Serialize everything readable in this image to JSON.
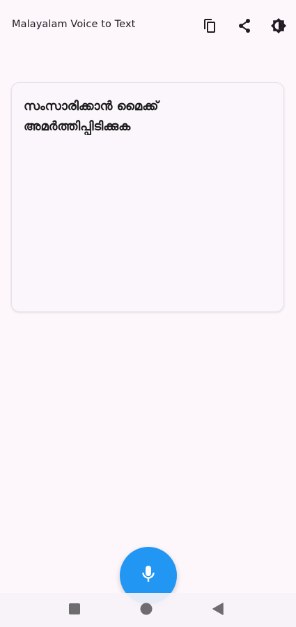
{
  "app_bar": {
    "title": "Malayalam Voice to Text",
    "actions": [
      {
        "name": "copy",
        "icon": "copy-icon"
      },
      {
        "name": "share",
        "icon": "share-icon"
      },
      {
        "name": "theme",
        "icon": "brightness-icon"
      }
    ]
  },
  "main": {
    "text_card": {
      "text": "സംസാരിക്കാൻ മൈക്ക് അമർത്തിപ്പിടിക്കുക"
    }
  },
  "fab": {
    "icon": "mic-icon",
    "color": "#2196f3"
  },
  "system_nav": {
    "buttons": [
      {
        "name": "recents",
        "icon": "square-icon"
      },
      {
        "name": "home",
        "icon": "circle-icon"
      },
      {
        "name": "back",
        "icon": "triangle-back-icon"
      }
    ]
  },
  "colors": {
    "background": "#fdf7fc",
    "accent": "#2196f3",
    "icon": "#1f1b21"
  }
}
